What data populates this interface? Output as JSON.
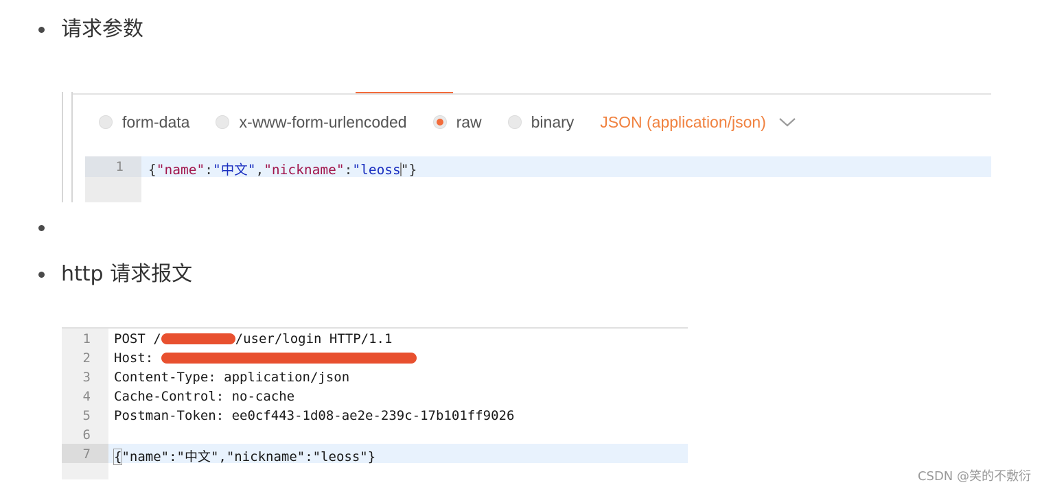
{
  "list": {
    "item1": "请求参数",
    "item3": "http 请求报文"
  },
  "postman": {
    "body_options": [
      {
        "label": "form-data",
        "selected": false
      },
      {
        "label": "x-www-form-urlencoded",
        "selected": false
      },
      {
        "label": "raw",
        "selected": true
      },
      {
        "label": "binary",
        "selected": false
      }
    ],
    "content_type": "JSON (application/json)",
    "editor": {
      "line_number": "1",
      "tokens": [
        "{",
        "\"name\"",
        ":",
        "\"中文\"",
        ",",
        "\"nickname\"",
        ":",
        "\"leoss",
        "\"}"
      ]
    }
  },
  "http_request": {
    "lines": [
      {
        "num": "1",
        "text_before": "POST /",
        "text_after": "/user/login HTTP/1.1",
        "redacted": true
      },
      {
        "num": "2",
        "text_before": "Host: ",
        "text_after": "",
        "redacted": true
      },
      {
        "num": "3",
        "text": "Content-Type: application/json"
      },
      {
        "num": "4",
        "text": "Cache-Control: no-cache"
      },
      {
        "num": "5",
        "text": "Postman-Token: ee0cf443-1d08-ae2e-239c-17b101ff9026"
      },
      {
        "num": "6",
        "text": ""
      },
      {
        "num": "7",
        "text_open": "{",
        "text": "\"name\":\"中文\",\"nickname\":\"leoss\"}",
        "highlight": true
      }
    ]
  },
  "watermark": "CSDN @笑的不敷衍",
  "colors": {
    "accent": "#f26b3a",
    "content_type": "#f0813f",
    "redaction": "#e8502f",
    "json_key": "#a1154c",
    "json_string": "#1a2fc0"
  }
}
